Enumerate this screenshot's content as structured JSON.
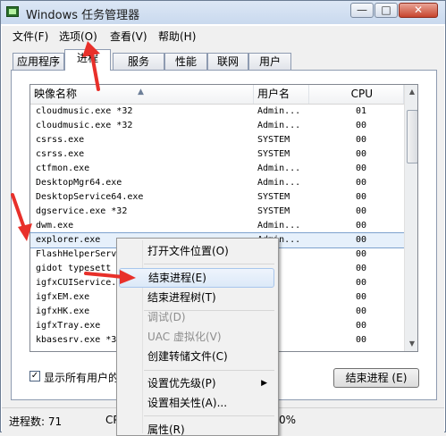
{
  "window": {
    "title": "Windows 任务管理器",
    "min_glyph": "—",
    "max_glyph": "□",
    "close_glyph": "✕"
  },
  "menubar": [
    "文件(F)",
    "选项(O)",
    "查看(V)",
    "帮助(H)"
  ],
  "tabs": [
    "应用程序",
    "进程",
    "服务",
    "性能",
    "联网",
    "用户"
  ],
  "active_tab": "进程",
  "columns": {
    "image": "映像名称",
    "user": "用户名",
    "cpu": "CPU"
  },
  "rows": [
    {
      "name": "cloudmusic.exe *32",
      "user": "Admin...",
      "cpu": "01"
    },
    {
      "name": "cloudmusic.exe *32",
      "user": "Admin...",
      "cpu": "00"
    },
    {
      "name": "csrss.exe",
      "user": "SYSTEM",
      "cpu": "00"
    },
    {
      "name": "csrss.exe",
      "user": "SYSTEM",
      "cpu": "00"
    },
    {
      "name": "ctfmon.exe",
      "user": "Admin...",
      "cpu": "00"
    },
    {
      "name": "DesktopMgr64.exe",
      "user": "Admin...",
      "cpu": "00"
    },
    {
      "name": "DesktopService64.exe",
      "user": "SYSTEM",
      "cpu": "00"
    },
    {
      "name": "dgservice.exe *32",
      "user": "SYSTEM",
      "cpu": "00"
    },
    {
      "name": "dwm.exe",
      "user": "Admin...",
      "cpu": "00"
    },
    {
      "name": "explorer.exe",
      "user": "Admin...",
      "cpu": "00"
    },
    {
      "name": "FlashHelperServ",
      "user": "",
      "cpu": "00"
    },
    {
      "name": "gidot typesett",
      "user": "",
      "cpu": "00"
    },
    {
      "name": "igfxCUIService.",
      "user": "",
      "cpu": "00"
    },
    {
      "name": "igfxEM.exe",
      "user": "",
      "cpu": "00"
    },
    {
      "name": "igfxHK.exe",
      "user": "",
      "cpu": "00"
    },
    {
      "name": "igfxTray.exe",
      "user": "",
      "cpu": "00"
    },
    {
      "name": "kbasesrv.exe *32",
      "user": "",
      "cpu": "00"
    }
  ],
  "selected_row": "explorer.exe",
  "show_all_users": {
    "label": "显示所有用户的",
    "checked": true,
    "check_glyph": "✓"
  },
  "end_process_button": "结束进程 (E)",
  "status": {
    "processes": "进程数: 71",
    "cpu": "CP",
    "memory": "0%"
  },
  "context_menu": {
    "items": [
      {
        "label": "打开文件位置(O)"
      },
      {
        "label": "结束进程(E)",
        "highlighted": true
      },
      {
        "label": "结束进程树(T)"
      },
      {
        "label": "调试(D)",
        "disabled": true
      },
      {
        "label": "UAC 虚拟化(V)",
        "disabled": true
      },
      {
        "label": "创建转储文件(C)"
      },
      {
        "label": "设置优先级(P)",
        "submenu": true
      },
      {
        "label": "设置相关性(A)..."
      },
      {
        "label": "属性(R)"
      }
    ],
    "submenu_glyph": "▶"
  },
  "annotation_color": "#e8302a",
  "icons": [
    "taskmgr-icon",
    "sort-up-icon",
    "scroll-up-icon",
    "scroll-down-icon",
    "check-icon",
    "submenu-arrow-icon",
    "annotation-arrow"
  ]
}
